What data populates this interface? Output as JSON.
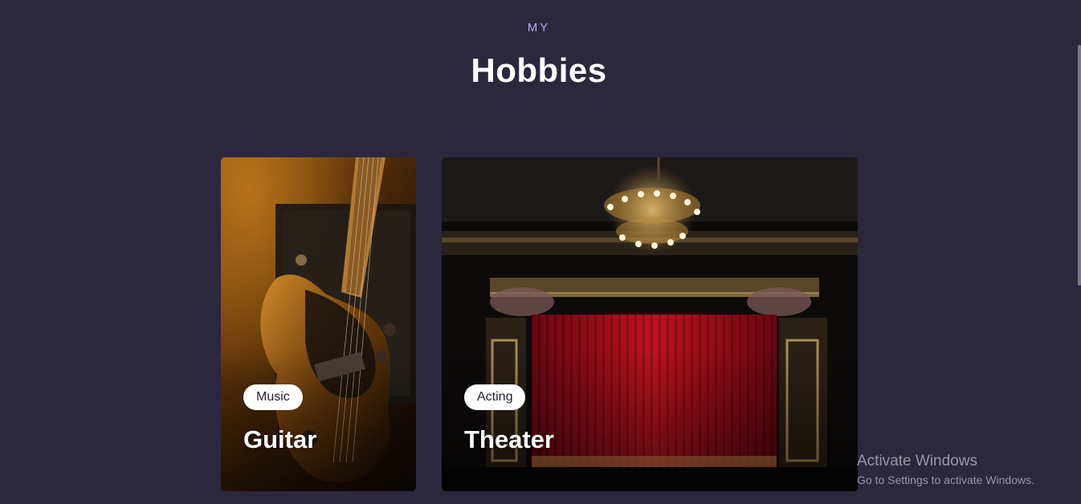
{
  "section": {
    "eyebrow": "MY",
    "title": "Hobbies"
  },
  "cards": [
    {
      "tag": "Music",
      "title": "Guitar"
    },
    {
      "tag": "Acting",
      "title": "Theater"
    }
  ],
  "watermark": {
    "title": "Activate Windows",
    "subtitle": "Go to Settings to activate Windows."
  },
  "colors": {
    "background": "#2b273d",
    "eyebrow": "#b3aef0",
    "tag_background": "#ffffff",
    "curtain": "#b0101f"
  }
}
